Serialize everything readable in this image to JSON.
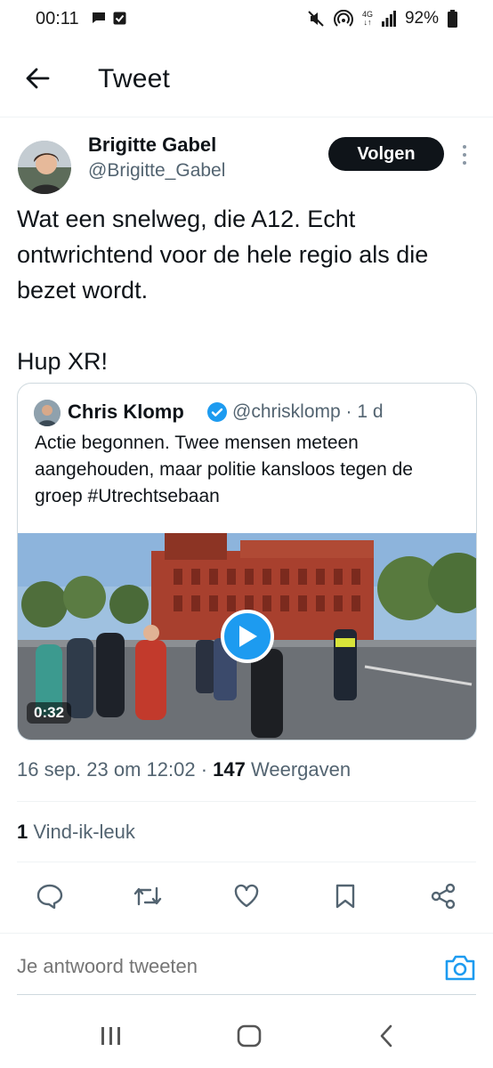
{
  "status_bar": {
    "time": "00:11",
    "network": "4G",
    "battery": "92%",
    "icons": [
      "chat-bubble-icon",
      "check-box-icon",
      "mute-icon",
      "hotspot-icon",
      "signal-icon",
      "battery-icon"
    ]
  },
  "header": {
    "title": "Tweet",
    "back_icon": "arrow-left-icon"
  },
  "tweet": {
    "author_name": "Brigitte Gabel",
    "author_handle": "@Brigitte_Gabel",
    "follow_label": "Volgen",
    "text": "Wat een snelweg, die A12. Echt ontwrichtend voor de hele regio als die bezet wordt.\n\nHup XR!",
    "timestamp": "16 sep. 23 om 12:02",
    "separator": " · ",
    "views_count": "147",
    "views_label": " Weergaven",
    "likes_count": "1",
    "likes_label": " Vind-ik-leuk"
  },
  "quoted": {
    "name": "Chris Klomp",
    "handle": "@chrisklomp · 1 d",
    "text": "Actie begonnen. Twee mensen meteen aangehouden, maar politie kansloos tegen de groep #Utrechtsebaan",
    "video_duration": "0:32"
  },
  "actions": [
    "reply-icon",
    "retweet-icon",
    "like-icon",
    "bookmark-icon",
    "share-icon"
  ],
  "reply": {
    "placeholder": "Je antwoord tweeten"
  },
  "colors": {
    "accent": "#1d9bf0",
    "text_primary": "#0f1419",
    "text_secondary": "#536471",
    "follow_bg": "#0f1419"
  }
}
